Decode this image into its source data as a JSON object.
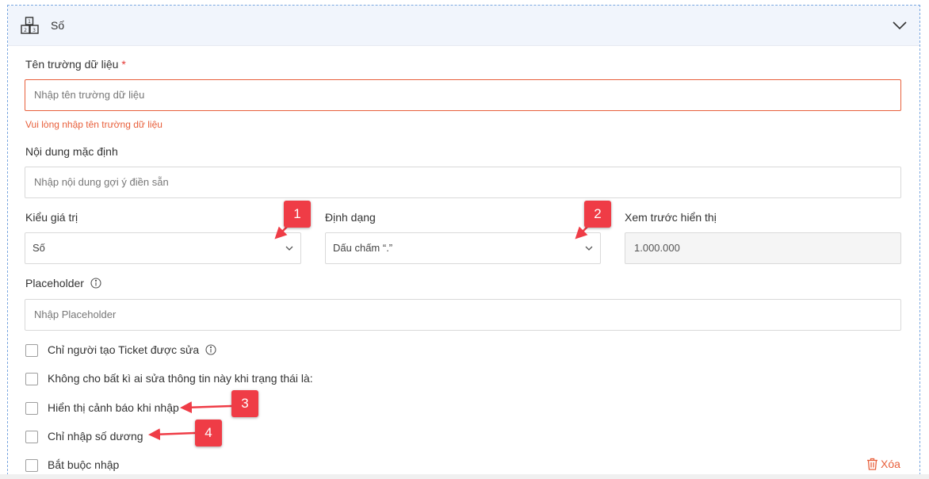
{
  "section": {
    "title": "Số",
    "icon": "number-blocks-icon",
    "collapse_icon": "chevron-down-icon"
  },
  "field_name": {
    "label": "Tên trường dữ liệu",
    "required_mark": "*",
    "placeholder": "Nhập tên trường dữ liệu",
    "error": "Vui lòng nhập tên trường dữ liệu"
  },
  "default_content": {
    "label": "Nội dung mặc định",
    "placeholder": "Nhập nội dung gợi ý điền sẵn"
  },
  "value_type": {
    "label": "Kiểu giá trị",
    "selected": "Số"
  },
  "format": {
    "label": "Định dạng",
    "selected": "Dấu chấm “.”"
  },
  "preview": {
    "label": "Xem trước hiển thị",
    "value": "1.000.000"
  },
  "placeholder_field": {
    "label": "Placeholder",
    "placeholder": "Nhập Placeholder"
  },
  "options": [
    {
      "label": "Chỉ người tạo Ticket được sửa",
      "checked": false
    },
    {
      "label": "Không cho bất kì ai sửa thông tin này khi trạng thái là:",
      "checked": false
    },
    {
      "label": "Hiển thị cảnh báo khi nhập",
      "checked": false
    },
    {
      "label": "Chỉ nhập số dương",
      "checked": false
    },
    {
      "label": "Bắt buộc nhập",
      "checked": false
    }
  ],
  "delete_label": "Xóa",
  "annotations": [
    "1",
    "2",
    "3",
    "4"
  ],
  "colors": {
    "accent_error": "#e8603c",
    "annotation": "#ef3c46",
    "header_bg": "#f1f5fc"
  }
}
